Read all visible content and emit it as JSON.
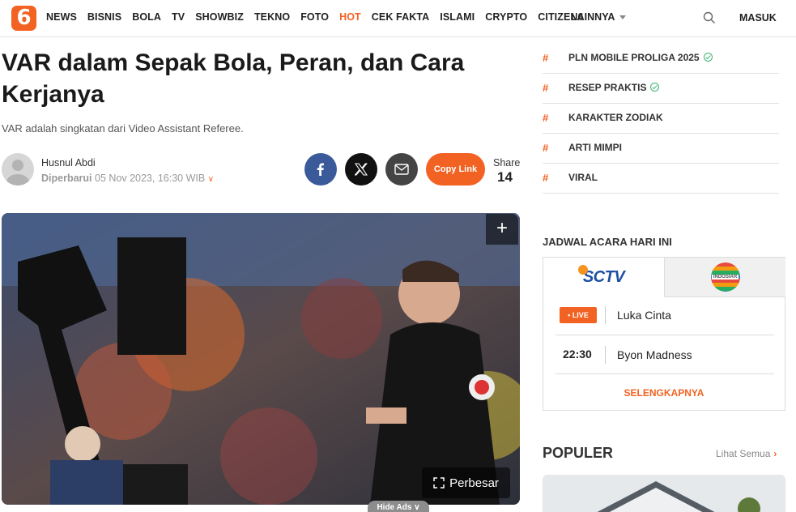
{
  "nav": {
    "logo": "6",
    "links": [
      "NEWS",
      "BISNIS",
      "BOLA",
      "TV",
      "SHOWBIZ",
      "TEKNO",
      "FOTO",
      "HOT",
      "CEK FAKTA",
      "ISLAMI",
      "CRYPTO",
      "CITIZEN6"
    ],
    "hot_color": "#f26222",
    "more": "LAINNYA",
    "login": "MASUK"
  },
  "article": {
    "title": "VAR dalam Sepak Bola, Peran, dan Cara Kerjanya",
    "subtitle": "VAR adalah singkatan dari Video Assistant Referee.",
    "author": "Husnul Abdi",
    "updated_label": "Diperbarui",
    "updated_time": "05 Nov 2023, 16:30 WIB",
    "copy_link": "Copy Link",
    "share_label": "Share",
    "share_count": "14",
    "enlarge": "Perbesar",
    "hide_ads": "Hide Ads"
  },
  "trending": [
    {
      "label": "PLN MOBILE PROLIGA 2025",
      "verified": true
    },
    {
      "label": "RESEP PRAKTIS",
      "verified": true
    },
    {
      "label": "KARAKTER ZODIAK",
      "verified": false
    },
    {
      "label": "ARTI MIMPI",
      "verified": false
    },
    {
      "label": "VIRAL",
      "verified": false
    }
  ],
  "schedule": {
    "title": "JADWAL ACARA HARI INI",
    "channels": [
      "SCTV",
      "INDOSIAR"
    ],
    "live_label": "LIVE",
    "programs": [
      {
        "time": "LIVE",
        "name": "Luka Cinta"
      },
      {
        "time": "22:30",
        "name": "Byon Madness"
      }
    ],
    "more": "SELENGKAPNYA"
  },
  "populer": {
    "title": "POPULER",
    "see_all": "Lihat Semua"
  },
  "colors": {
    "accent": "#f26222",
    "facebook": "#3b5a9a",
    "verified": "#3cb371"
  }
}
